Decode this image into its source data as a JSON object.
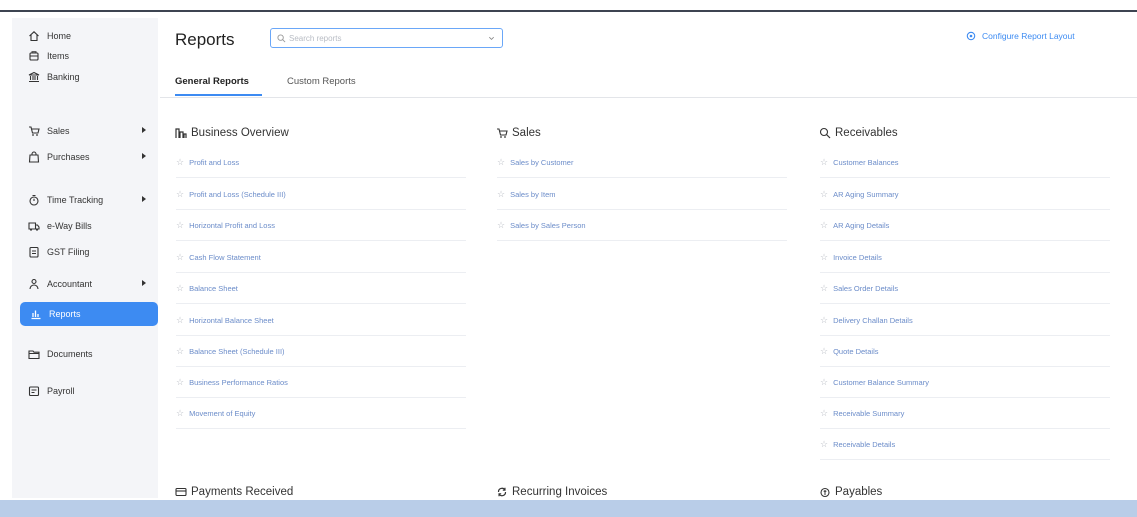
{
  "sidebar": {
    "items": [
      {
        "label": "Home",
        "icon": "home-icon",
        "has_submenu": false
      },
      {
        "label": "Items",
        "icon": "items-icon",
        "has_submenu": false
      },
      {
        "label": "Banking",
        "icon": "bank-icon",
        "has_submenu": false
      },
      {
        "label": "Sales",
        "icon": "cart-icon",
        "has_submenu": true
      },
      {
        "label": "Purchases",
        "icon": "bag-icon",
        "has_submenu": true
      },
      {
        "label": "Time Tracking",
        "icon": "timer-icon",
        "has_submenu": true
      },
      {
        "label": "e-Way Bills",
        "icon": "truck-icon",
        "has_submenu": false
      },
      {
        "label": "GST Filing",
        "icon": "document-icon",
        "has_submenu": false
      },
      {
        "label": "Accountant",
        "icon": "user-icon",
        "has_submenu": true
      },
      {
        "label": "Reports",
        "icon": "chart-icon",
        "has_submenu": false,
        "active": true
      },
      {
        "label": "Documents",
        "icon": "folder-icon",
        "has_submenu": false
      },
      {
        "label": "Payroll",
        "icon": "payroll-icon",
        "has_submenu": false
      }
    ]
  },
  "header": {
    "title": "Reports",
    "search_placeholder": "Search reports",
    "configure_label": "Configure Report Layout"
  },
  "tabs": [
    {
      "label": "General Reports",
      "active": true
    },
    {
      "label": "Custom Reports",
      "active": false
    }
  ],
  "sections": {
    "business_overview": {
      "title": "Business Overview",
      "icon": "business-icon",
      "reports": [
        "Profit and Loss",
        "Profit and Loss (Schedule III)",
        "Horizontal Profit and Loss",
        "Cash Flow Statement",
        "Balance Sheet",
        "Horizontal Balance Sheet",
        "Balance Sheet (Schedule III)",
        "Business Performance Ratios",
        "Movement of Equity"
      ]
    },
    "sales": {
      "title": "Sales",
      "icon": "cart-icon",
      "reports": [
        "Sales by Customer",
        "Sales by Item",
        "Sales by Sales Person"
      ]
    },
    "receivables": {
      "title": "Receivables",
      "icon": "receivables-icon",
      "reports": [
        "Customer Balances",
        "AR Aging Summary",
        "AR Aging Details",
        "Invoice Details",
        "Sales Order Details",
        "Delivery Challan Details",
        "Quote Details",
        "Customer Balance Summary",
        "Receivable Summary",
        "Receivable Details"
      ]
    },
    "payments_received": {
      "title": "Payments Received",
      "icon": "payments-icon"
    },
    "recurring_invoices": {
      "title": "Recurring Invoices",
      "icon": "recurring-icon"
    },
    "payables": {
      "title": "Payables",
      "icon": "payables-icon"
    }
  },
  "colors": {
    "accent": "#3d8bf2",
    "link": "#6b8cc9",
    "sidebar_bg": "#f4f5f8",
    "status_bar": "#b9cde8"
  }
}
